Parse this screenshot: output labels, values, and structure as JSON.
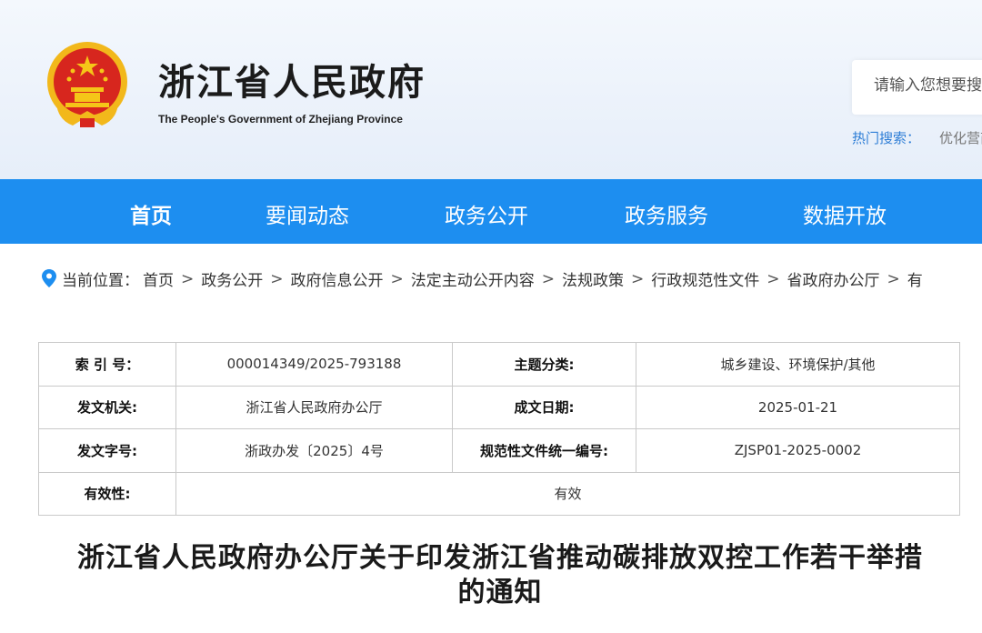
{
  "header": {
    "title": "浙江省人民政府",
    "subtitle": "The People's Government of Zhejiang Province",
    "search_placeholder": "请输入您想要搜索的内容",
    "hot_search_label": "热门搜索：",
    "hot_search_item": "优化营商环境"
  },
  "nav": {
    "items": [
      "首页",
      "要闻动态",
      "政务公开",
      "政务服务",
      "数据开放"
    ]
  },
  "breadcrumb": {
    "label": "当前位置：",
    "items": [
      "首页",
      "政务公开",
      "政府信息公开",
      "法定主动公开内容",
      "法规政策",
      "行政规范性文件",
      "省政府办公厅",
      "有"
    ]
  },
  "info": {
    "index_key": "索 引 号：",
    "index_val": "000014349/2025-793188",
    "topic_key": "主题分类:",
    "topic_val": "城乡建设、环境保护/其他",
    "issuer_key": "发文机关:",
    "issuer_val": "浙江省人民政府办公厅",
    "date_key": "成文日期:",
    "date_val": "2025-01-21",
    "docno_key": "发文字号:",
    "docno_val": "浙政办发〔2025〕4号",
    "code_key": "规范性文件统一编号:",
    "code_val": "ZJSP01-2025-0002",
    "valid_key": "有效性:",
    "valid_val": "有效"
  },
  "document": {
    "title_line1": "浙江省人民政府办公厅关于印发浙江省推动碳排放双控工作若干举措",
    "title_line2": "的通知"
  },
  "colors": {
    "nav_bg": "#1d8ef0",
    "hot_label": "#2e7ed6",
    "emblem_red": "#d7261e",
    "emblem_gold": "#f5c518"
  },
  "icons": {
    "emblem": "national-emblem-icon",
    "location": "location-pin-icon"
  }
}
